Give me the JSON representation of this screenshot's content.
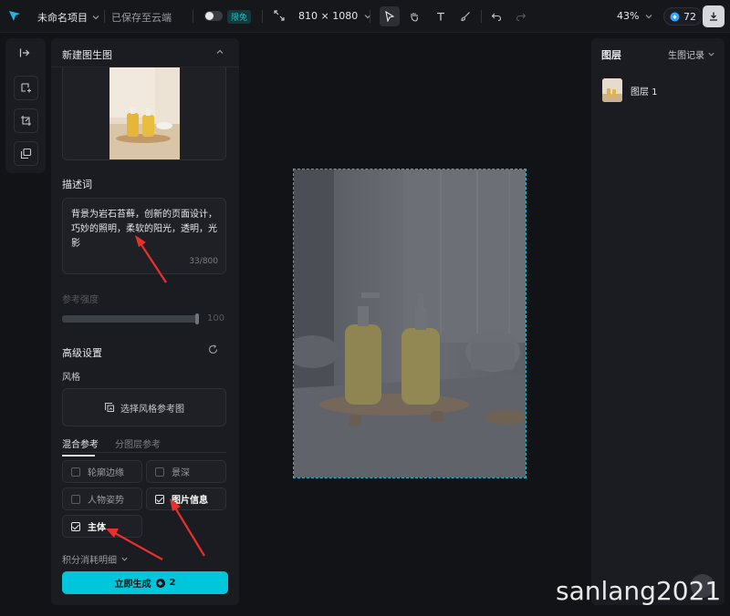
{
  "topbar": {
    "project_name": "未命名项目",
    "save_status": "已保存至云端",
    "limited_badge": "限免",
    "canvas_size": "810 × 1080",
    "zoom": "43%",
    "credits": "72"
  },
  "panel": {
    "title": "新建图生图",
    "prompt_label": "描述词",
    "prompt_text": "背景为岩石苔藓，创新的页面设计，巧妙的照明，柔软的阳光，透明，光影",
    "prompt_counter": "33/800",
    "ref_strength_label": "参考强度",
    "ref_strength": 100,
    "ref_strength_text": "100",
    "advanced_label": "高级设置",
    "style_label": "风格",
    "style_button": "选择风格参考图",
    "tabs": [
      {
        "label": "混合参考",
        "active": true
      },
      {
        "label": "分图层参考",
        "active": false
      }
    ],
    "options": [
      {
        "label": "轮廓边缘",
        "checked": false
      },
      {
        "label": "景深",
        "checked": false
      },
      {
        "label": "人物姿势",
        "checked": false
      },
      {
        "label": "图片信息",
        "checked": true
      },
      {
        "label": "主体",
        "checked": true
      }
    ],
    "cost_label": "积分消耗明细",
    "generate_label": "立即生成",
    "generate_cost": "2"
  },
  "canvas_frame": {
    "border_color": "#21b8c8"
  },
  "layers": {
    "title": "图层",
    "history_label": "生图记录",
    "items": [
      {
        "label": "图层 1"
      }
    ]
  },
  "watermark": "sanlang2021",
  "colors": {
    "accent": "#00c6dc",
    "annotation_arrow": "#e8312a"
  }
}
